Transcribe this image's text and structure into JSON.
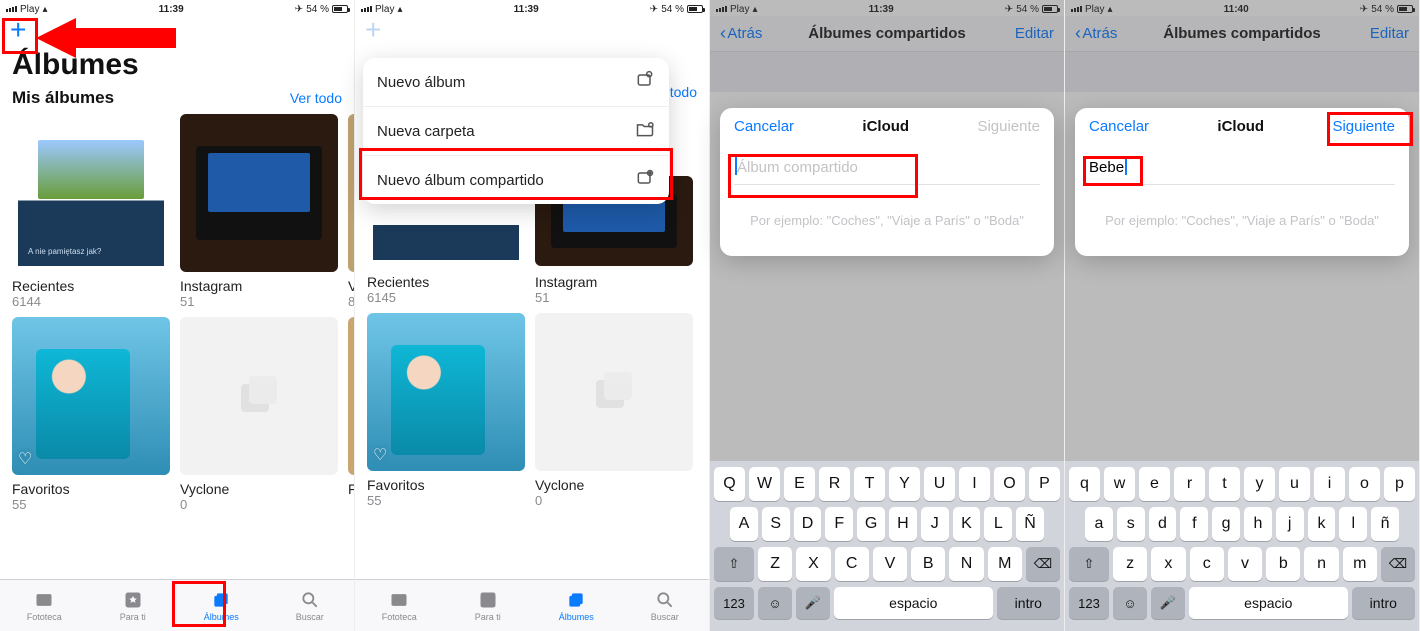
{
  "status": {
    "carrier": "Play",
    "time": "11:39",
    "time4": "11:40",
    "batt": "54 %",
    "loc": "✈"
  },
  "s1": {
    "title": "Álbumes",
    "section": "Mis álbumes",
    "see_all": "Ver todo",
    "albums": [
      {
        "name": "Recientes",
        "count": "6144"
      },
      {
        "name": "Instagram",
        "count": "51"
      },
      {
        "name": "V",
        "count": "8"
      },
      {
        "name": "Favoritos",
        "count": "55"
      },
      {
        "name": "Vyclone",
        "count": "0"
      },
      {
        "name": "F",
        "count": ""
      }
    ],
    "tabs": [
      "Fototeca",
      "Para ti",
      "Álbumes",
      "Buscar"
    ]
  },
  "s2": {
    "see_all": "Ver todo",
    "menu": [
      "Nuevo álbum",
      "Nueva carpeta",
      "Nuevo álbum compartido"
    ],
    "albums": [
      {
        "name": "Recientes",
        "count": "6145"
      },
      {
        "name": "Instagram",
        "count": "51"
      },
      {
        "name": "Favoritos",
        "count": "55"
      },
      {
        "name": "Vyclone",
        "count": "0"
      }
    ],
    "tabs": [
      "Fototeca",
      "Para ti",
      "Álbumes",
      "Buscar"
    ]
  },
  "shared": {
    "back": "Atrás",
    "title": "Álbumes compartidos",
    "edit": "Editar",
    "cancel": "Cancelar",
    "sheet_title": "iCloud",
    "next": "Siguiente",
    "placeholder": "Álbum compartido",
    "hint": "Por ejemplo: \"Coches\", \"Viaje a París\" o \"Boda\"",
    "input4": "Bebe"
  },
  "kb": {
    "row1_u": [
      "Q",
      "W",
      "E",
      "R",
      "T",
      "Y",
      "U",
      "I",
      "O",
      "P"
    ],
    "row2_u": [
      "A",
      "S",
      "D",
      "F",
      "G",
      "H",
      "J",
      "K",
      "L",
      "Ñ"
    ],
    "row3_u": [
      "Z",
      "X",
      "C",
      "V",
      "B",
      "N",
      "M"
    ],
    "row1_l": [
      "q",
      "w",
      "e",
      "r",
      "t",
      "y",
      "u",
      "i",
      "o",
      "p"
    ],
    "row2_l": [
      "a",
      "s",
      "d",
      "f",
      "g",
      "h",
      "j",
      "k",
      "l",
      "ñ"
    ],
    "row3_l": [
      "z",
      "x",
      "c",
      "v",
      "b",
      "n",
      "m"
    ],
    "n123": "123",
    "space": "espacio",
    "intro": "intro"
  },
  "recent_caption": "A nie pamiętasz jak?"
}
